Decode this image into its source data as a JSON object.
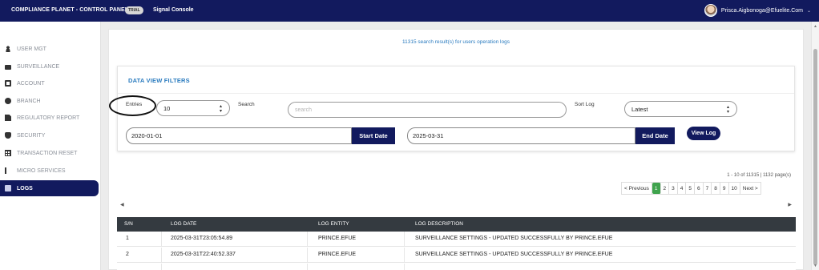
{
  "header": {
    "brand": "COMPLIANCE PLANET - CONTROL PANEL",
    "trial_badge": "TRIAL",
    "console": "Signal Console",
    "user_email": "Prisca.Aigbonoga@Efuelite.Com",
    "user_caret": "⌄"
  },
  "sidebar": {
    "items": [
      {
        "label": "USER MGT",
        "icon": "person-icon"
      },
      {
        "label": "SURVEILLANCE",
        "icon": "briefcase-icon"
      },
      {
        "label": "ACCOUNT",
        "icon": "book-icon"
      },
      {
        "label": "BRANCH",
        "icon": "user-circle-icon"
      },
      {
        "label": "REGULATORY REPORT",
        "icon": "document-icon"
      },
      {
        "label": "SECURITY",
        "icon": "shield-icon"
      },
      {
        "label": "TRANSACTION RESET",
        "icon": "grid-icon"
      },
      {
        "label": "MICRO SERVICES",
        "icon": "branch-icon"
      },
      {
        "label": "LOGS",
        "icon": "logs-icon",
        "active": true
      }
    ]
  },
  "main": {
    "results_text": "11315 search result(s) for users operation logs",
    "filters": {
      "title": "DATA VIEW FILTERS",
      "entries_label": "Entries",
      "entries_value": "10",
      "search_label": "Search",
      "search_placeholder": "search",
      "sort_label": "Sort Log",
      "sort_value": "Latest",
      "start_date": "2020-01-01",
      "start_button": "Start Date",
      "end_date": "2025-03-31",
      "end_button": "End Date",
      "view_button": "View Log"
    },
    "pagination": {
      "info": "1 - 10 of 11315 | 1132 page(s)",
      "prev": "< Previous",
      "pages": [
        "1",
        "2",
        "3",
        "4",
        "5",
        "6",
        "7",
        "8",
        "9",
        "10"
      ],
      "next": "Next >",
      "active_page": "1"
    },
    "table": {
      "headers": [
        "S/N",
        "LOG DATE",
        "LOG ENTITY",
        "LOG DESCRIPTION"
      ],
      "rows": [
        [
          "1",
          "2025-03-31T23:05:54.89",
          "PRINCE.EFUE",
          "SURVEILLANCE SETTINGS - UPDATED SUCCESSFULLY BY PRINCE.EFUE"
        ],
        [
          "2",
          "2025-03-31T22:40:52.337",
          "PRINCE.EFUE",
          "SURVEILLANCE SETTINGS - UPDATED SUCCESSFULLY BY PRINCE.EFUE"
        ]
      ]
    }
  },
  "colors": {
    "navy": "#121a5e",
    "link_blue": "#2a7bbf",
    "page_active": "#3fa34d",
    "table_header": "#343a40"
  }
}
